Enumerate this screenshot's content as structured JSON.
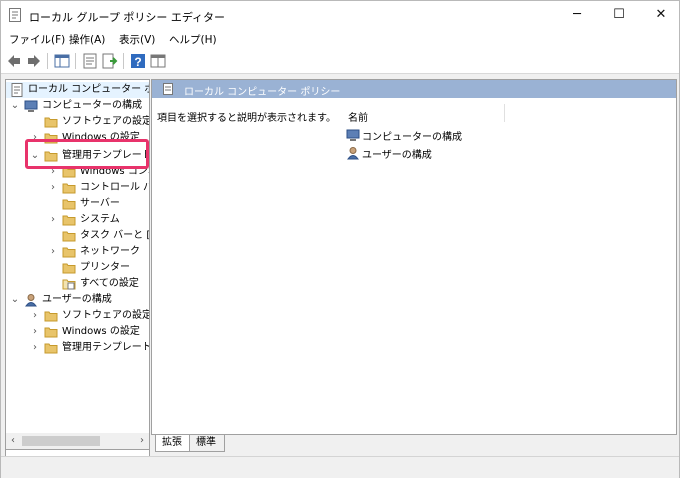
{
  "window": {
    "title": "ローカル グループ ポリシー エディター",
    "minimize": "─",
    "maximize": "☐",
    "close": "✕"
  },
  "menu": [
    "ファイル(F)",
    "操作(A)",
    "表示(V)",
    "ヘルプ(H)"
  ],
  "toolbar": [
    "back-icon",
    "forward-icon",
    "show-hide-tree-icon",
    "properties-icon",
    "export-list-icon",
    "help-icon",
    "filter-view-icon"
  ],
  "tree": {
    "root": "ローカル コンピューター ポリシー",
    "computer": "コンピューターの構成",
    "computer_software": "ソフトウェアの設定",
    "computer_windows": "Windows の設定",
    "computer_admin": "管理用テンプレート",
    "admin_children": [
      "Windows コンポーネント",
      "コントロール パネル",
      "サーバー",
      "システム",
      "タスク バーと [スタート] メニュー",
      "ネットワーク",
      "プリンター",
      "すべての設定"
    ],
    "user": "ユーザーの構成",
    "user_software": "ソフトウェアの設定",
    "user_windows": "Windows の設定",
    "user_admin": "管理用テンプレート"
  },
  "right": {
    "header": "ローカル コンピューター ポリシー",
    "description": "項目を選択すると説明が表示されます。",
    "column_name": "名前",
    "items": [
      "コンピューターの構成",
      "ユーザーの構成"
    ]
  },
  "tabs": [
    "拡張",
    "標準"
  ],
  "colors": {
    "highlight": "#e8336b",
    "header_bg": "#9ab2d4",
    "folder": "#e8c46a"
  }
}
